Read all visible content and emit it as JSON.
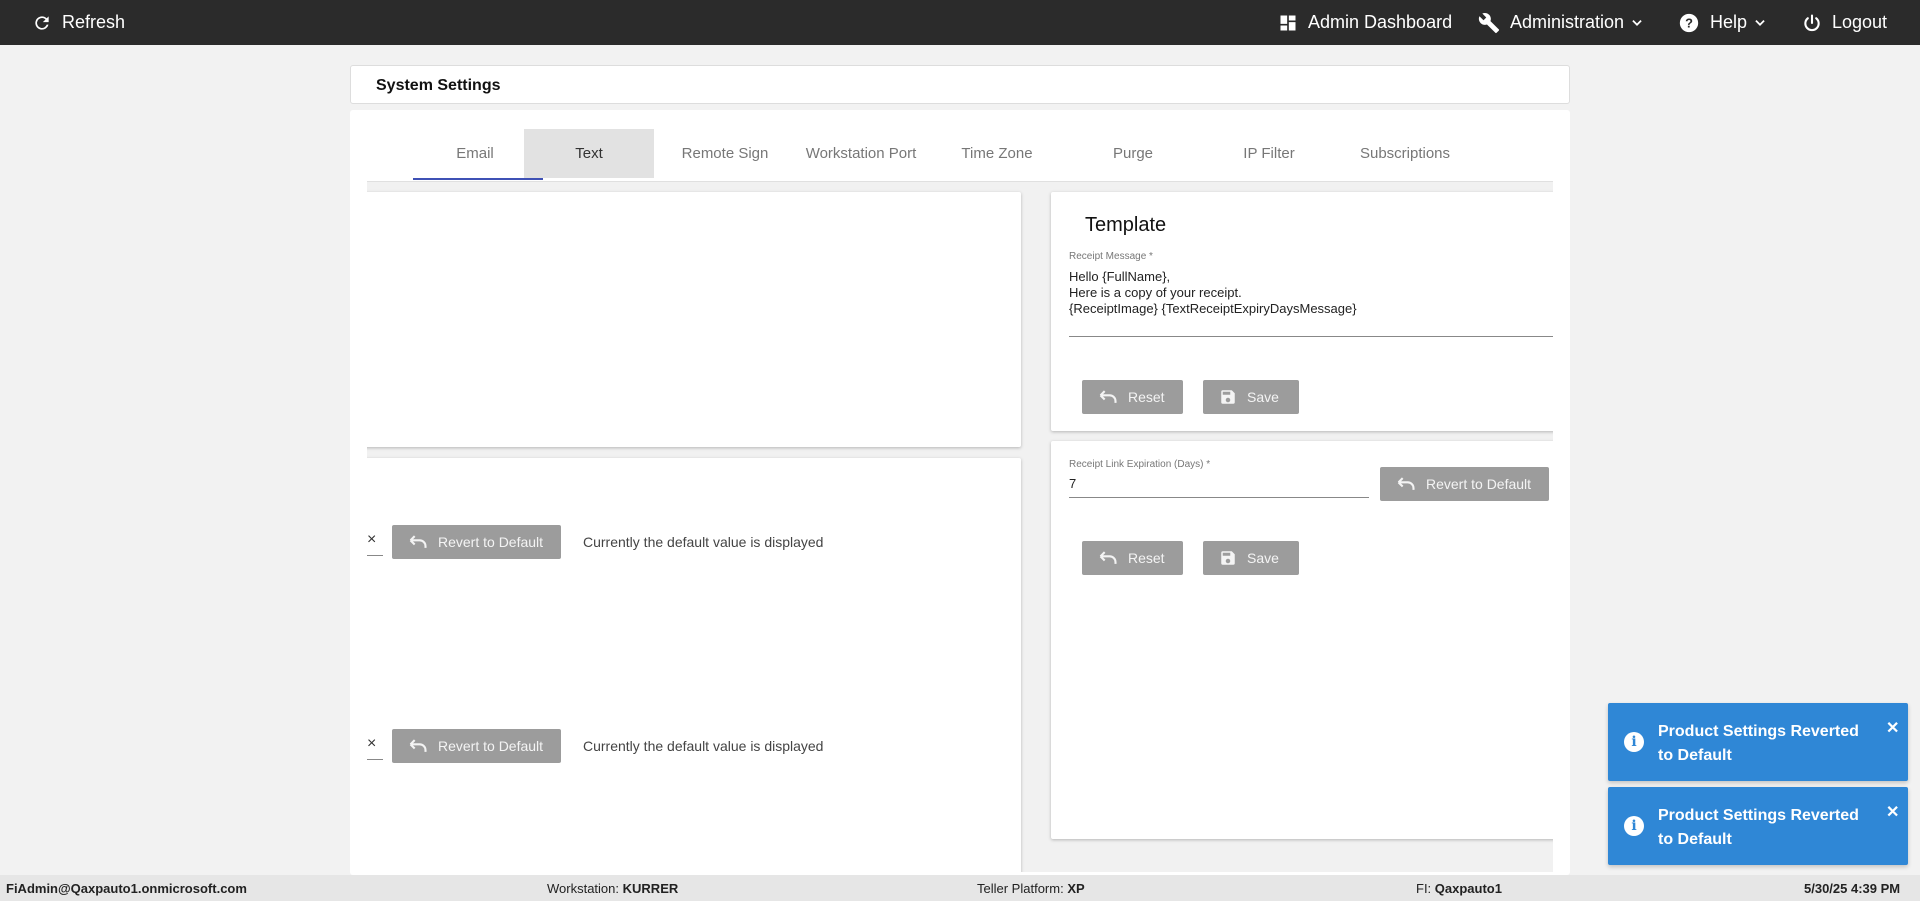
{
  "topbar": {
    "refresh_label": "Refresh",
    "admin_dashboard_label": "Admin Dashboard",
    "administration_label": "Administration",
    "help_label": "Help",
    "logout_label": "Logout"
  },
  "page": {
    "title": "System Settings"
  },
  "tabs": [
    {
      "label": "Email"
    },
    {
      "label": "Text"
    },
    {
      "label": "Remote Sign"
    },
    {
      "label": "Workstation Port"
    },
    {
      "label": "Time Zone"
    },
    {
      "label": "Purge"
    },
    {
      "label": "IP Filter"
    },
    {
      "label": "Subscriptions"
    }
  ],
  "active_tab": "Text",
  "left_settings": [
    {
      "clear_icon": "×",
      "revert_label": "Revert to Default",
      "status": "Currently the default value is displayed"
    },
    {
      "clear_icon": "×",
      "revert_label": "Revert to Default",
      "status": "Currently the default value is displayed"
    }
  ],
  "template": {
    "title": "Template",
    "receipt_message_label": "Receipt Message *",
    "receipt_message_value": "Hello {FullName},\nHere is a copy of your receipt.\n{ReceiptImage} {TextReceiptExpiryDaysMessage}",
    "reset_label": "Reset",
    "save_label": "Save"
  },
  "expiration": {
    "label": "Receipt Link Expiration (Days) *",
    "value": "7",
    "revert_label": "Revert to Default",
    "reset_label": "Reset",
    "save_label": "Save"
  },
  "toasts": [
    {
      "message": "Product Settings Reverted to Default"
    },
    {
      "message": "Product Settings Reverted to Default"
    }
  ],
  "footer": {
    "user": "FiAdmin@Qaxpauto1.onmicrosoft.com",
    "workstation_label": "Workstation:",
    "workstation_value": "KURRER",
    "platform_label": "Teller Platform:",
    "platform_value": "XP",
    "fi_label": "FI:",
    "fi_value": "Qaxpauto1",
    "datetime": "5/30/25 4:39 PM"
  },
  "colors": {
    "topbar": "#2b2b2b",
    "accent": "#3f51b5",
    "toast": "#2f87d6",
    "disabled_button": "#9c9c9c"
  }
}
